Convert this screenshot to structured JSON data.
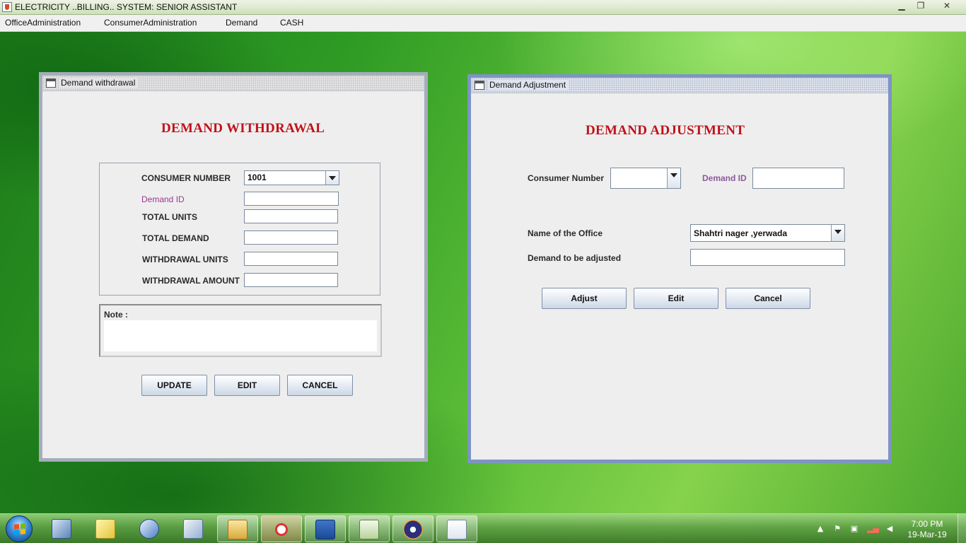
{
  "window": {
    "title": "ELECTRICITY ..BILLING.. SYSTEM: SENIOR ASSISTANT",
    "minimize": "▁",
    "restore": "❐",
    "close": "✕"
  },
  "menu": [
    {
      "label": "OfficeAdministration"
    },
    {
      "label": "ConsumerAdministration"
    },
    {
      "label": "Demand"
    },
    {
      "label": "CASH"
    }
  ],
  "withdrawal": {
    "frame_title": "Demand withdrawal",
    "heading": "DEMAND WITHDRAWAL",
    "consumer_number_label": "CONSUMER NUMBER",
    "consumer_number_value": "1001",
    "demand_id_label": "Demand ID",
    "total_units_label": "TOTAL UNITS",
    "total_demand_label": "TOTAL DEMAND",
    "withdrawal_units_label": "WITHDRAWAL UNITS",
    "withdrawal_amount_label": "WITHDRAWAL AMOUNT",
    "note_label": "Note  :",
    "buttons": {
      "update": "UPDATE",
      "edit": "EDIT",
      "cancel": "CANCEL"
    }
  },
  "adjustment": {
    "frame_title": "Demand Adjustment",
    "heading": "DEMAND ADJUSTMENT",
    "consumer_number_label": "Consumer Number",
    "consumer_number_value": "",
    "demand_id_label": "Demand ID",
    "office_label": "Name of the Office",
    "office_value": "Shahtri nager ,yerwada",
    "demand_adjusted_label": "Demand to be adjusted",
    "buttons": {
      "adjust": "Adjust",
      "edit": "Edit",
      "cancel": "Cancel"
    }
  },
  "taskbar": {
    "time": "7:00 PM",
    "date": "19-Mar-19",
    "icons": [
      "computer-icon",
      "folder-notes-icon",
      "network-icon",
      "control-panel-icon",
      "file-manager-icon",
      "snipping-tool-icon",
      "word-icon",
      "editor-icon",
      "eclipse-icon",
      "java-icon"
    ],
    "tray": [
      "show-hidden-icon",
      "action-center-flag-icon",
      "device-icon",
      "network-signal-icon",
      "volume-icon"
    ]
  },
  "colors": {
    "heading_red": "#c0121a",
    "demand_id_purple": "#9a3a92",
    "frame_border_active": "#7e94c4"
  }
}
